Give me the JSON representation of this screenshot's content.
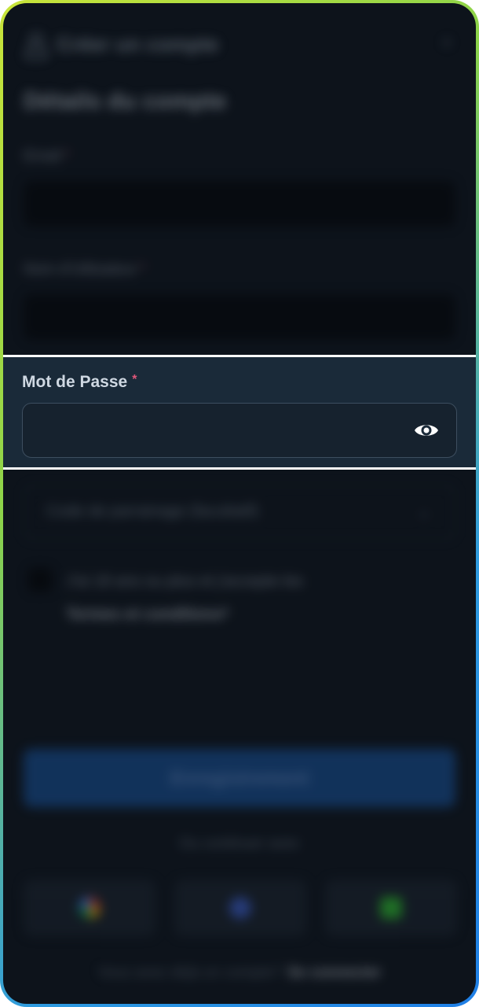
{
  "header": {
    "title": "Créer un compte",
    "user_icon": "user-icon",
    "close_icon": "close-icon"
  },
  "section": {
    "title": "Détails du compte"
  },
  "fields": {
    "email": {
      "label": "Email",
      "required_mark": "*"
    },
    "username": {
      "label": "Nom d'Utilisateur",
      "required_mark": "*"
    },
    "password": {
      "label": "Mot de Passe",
      "required_mark": "*",
      "value": "",
      "toggle_icon": "eye-icon"
    },
    "referral": {
      "placeholder": "Code de parrainage (facultatif)",
      "chevron_icon": "chevron-down-icon"
    }
  },
  "terms": {
    "line1": "J'ai 18 ans ou plus et j'accepte les",
    "line2": "Termes et conditions",
    "required_mark": "*"
  },
  "register_button": {
    "label": "Enregistrement",
    "color": "#164c8f"
  },
  "divider": {
    "text": "Ou continuer avec"
  },
  "social": [
    {
      "name": "google",
      "icon": "google-icon",
      "color": "#db4437"
    },
    {
      "name": "facebook",
      "icon": "facebook-icon",
      "color": "#3b5cc4"
    },
    {
      "name": "line",
      "icon": "line-icon",
      "color": "#2eb82e"
    }
  ],
  "footer": {
    "text": "Vous avez déjà un compte?",
    "link": "Se connecter"
  },
  "colors": {
    "accent_border": "#ffffff",
    "required": "#e0577a",
    "background": "#0d131b"
  }
}
